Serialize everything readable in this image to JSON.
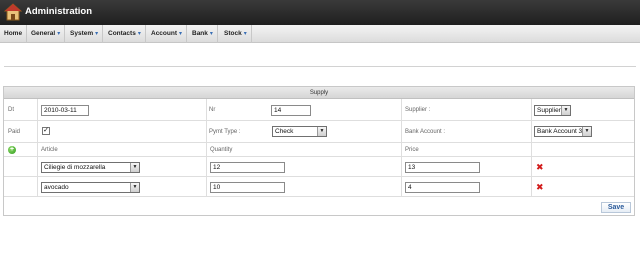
{
  "app": {
    "title": "Administration",
    "logo_icon": "house-icon"
  },
  "menu": {
    "items": [
      {
        "label": "Home",
        "has_dropdown": false
      },
      {
        "label": "General",
        "has_dropdown": true
      },
      {
        "label": "System",
        "has_dropdown": true
      },
      {
        "label": "Contacts",
        "has_dropdown": true
      },
      {
        "label": "Account",
        "has_dropdown": true
      },
      {
        "label": "Bank",
        "has_dropdown": true
      },
      {
        "label": "Stock",
        "has_dropdown": true
      }
    ]
  },
  "supply": {
    "title": "Supply",
    "dt_label": "Dt",
    "dt_value": "2010-03-11",
    "nr_label": "Nr",
    "nr_value": "14",
    "supplier_label": "Supplier :",
    "supplier_value": "Supplier",
    "paid_label": "Paid",
    "paid_checked": true,
    "pymt_type_label": "Pymt Type :",
    "pymt_type_value": "Check",
    "bank_account_label": "Bank Account :",
    "bank_account_value": "Bank Account 3",
    "columns": {
      "article": "Article",
      "quantity": "Quantity",
      "price": "Price"
    },
    "lines": [
      {
        "article": "Ciliegie di mozzarella",
        "quantity": "12",
        "price": "13"
      },
      {
        "article": "avocado",
        "quantity": "10",
        "price": "4"
      }
    ],
    "save_label": "Save"
  },
  "colors": {
    "topbar": "#2a2a2a",
    "accent": "#2a5a9a",
    "delete": "#d21a1a",
    "add": "#3aa52a"
  }
}
